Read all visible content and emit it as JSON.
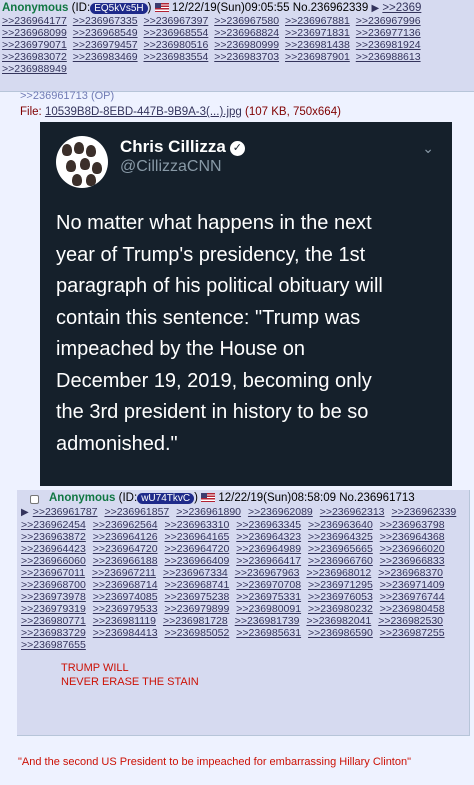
{
  "post1": {
    "name": "Anonymous",
    "id_label": "(ID:",
    "id_value": "EQ5kVs5H",
    "id_close": ")",
    "datetime": "12/22/19(Sun)09:05:55",
    "post_no": "No.236962339",
    "arrow": "▶",
    "trail": ">>2369",
    "replies": [
      ">>236964177",
      ">>236967335",
      ">>236967397",
      ">>236967580",
      ">>236967881",
      ">>236967996",
      ">>236968099",
      ">>236968549",
      ">>236968554",
      ">>236968824",
      ">>236971831",
      ">>236977136",
      ">>236979071",
      ">>236979457",
      ">>236980516",
      ">>236980999",
      ">>236981438",
      ">>236981924",
      ">>236983072",
      ">>236983469",
      ">>236983554",
      ">>236983703",
      ">>236987901",
      ">>236988613",
      ">>236988949"
    ]
  },
  "op_link": ">>236961713 (OP)",
  "file": {
    "label": "File:",
    "name": "10539B8D-8EBD-447B-9B9A-3(...).jpg",
    "meta": "(107 KB, 750x664)"
  },
  "tweet": {
    "name": "Chris Cillizza",
    "verified": "✓",
    "handle": "@CillizzaCNN",
    "chevron": "⌄",
    "text": "No matter what happens in the next\nyear of Trump's presidency, the 1st\nparagraph of his political obituary will\ncontain this sentence: \"Trump was\nimpeached by the House on\nDecember 19, 2019, becoming only\nthe 3rd president in history to be so\nadmonished.\""
  },
  "post2": {
    "name": "Anonymous",
    "id_label": "(ID:",
    "id_value": "wU74TkvC",
    "id_close": ")",
    "datetime": "12/22/19(Sun)08:58:09",
    "post_no": "No.236961713",
    "arrow": "▶",
    "replies": [
      ">>236961787",
      ">>236961857",
      ">>236961890",
      ">>236962089",
      ">>236962313",
      ">>236962339",
      ">>236962454",
      ">>236962564",
      ">>236963310",
      ">>236963345",
      ">>236963640",
      ">>236963798",
      ">>236963872",
      ">>236964126",
      ">>236964165",
      ">>236964323",
      ">>236964325",
      ">>236964368",
      ">>236964423",
      ">>236964720",
      ">>236964720",
      ">>236964989",
      ">>236965665",
      ">>236966020",
      ">>236966060",
      ">>236966188",
      ">>236966409",
      ">>236966417",
      ">>236966760",
      ">>236966833",
      ">>236967011",
      ">>236967211",
      ">>236967334",
      ">>236967963",
      ">>236968012",
      ">>236968370",
      ">>236968700",
      ">>236968714",
      ">>236968741",
      ">>236970708",
      ">>236971295",
      ">>236971409",
      ">>236973978",
      ">>236974085",
      ">>236975238",
      ">>236975331",
      ">>236976053",
      ">>236976744",
      ">>236979319",
      ">>236979533",
      ">>236979899",
      ">>236980091",
      ">>236980232",
      ">>236980458",
      ">>236980771",
      ">>236981119",
      ">>236981728",
      ">>236981739",
      ">>236982041",
      ">>236982530",
      ">>236983729",
      ">>236984413",
      ">>236985052",
      ">>236985631",
      ">>236986590",
      ">>236987255",
      ">>236987655"
    ],
    "message": "TRUMP WILL\nNEVER ERASE THE STAIN"
  },
  "bottom_message": "\"And the second US President to be impeached for embarrassing Hillary Clinton\""
}
